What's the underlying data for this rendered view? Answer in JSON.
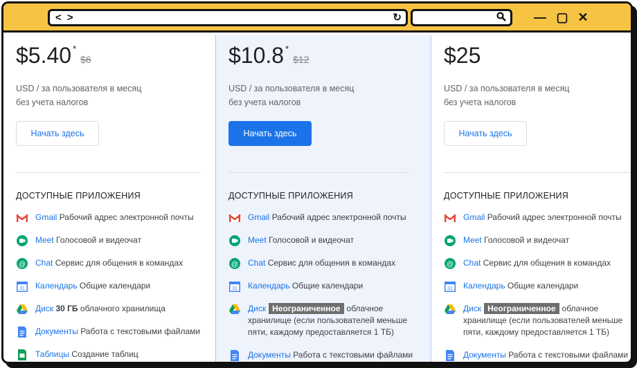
{
  "browser": {
    "nav_arrows": "< >"
  },
  "section_title": "ДОСТУПНЫЕ ПРИЛОЖЕНИЯ",
  "plans": [
    {
      "price": "$5.40",
      "star": "*",
      "old_price": "$6",
      "sub1": "USD / за пользователя в месяц",
      "sub2": "без учета налогов",
      "button": "Начать здесь",
      "apps": [
        {
          "name": "Gmail",
          "desc": "Рабочий адрес электронной почты"
        },
        {
          "name": "Meet",
          "desc": "Голосовой и видеочат"
        },
        {
          "name": "Chat",
          "desc": "Сервис для общения в командах"
        },
        {
          "name": "Календарь",
          "desc": "Общие календари"
        },
        {
          "name": "Диск",
          "pre": "30 ГБ",
          "desc": "облачного хранилища"
        },
        {
          "name": "Документы",
          "desc": "Работа с текстовыми файлами"
        },
        {
          "name": "Таблицы",
          "desc": "Создание таблиц"
        }
      ]
    },
    {
      "price": "$10.8",
      "star": "*",
      "old_price": "$12",
      "sub1": "USD / за пользователя в месяц",
      "sub2": "без учета налогов",
      "button": "Начать здесь",
      "apps": [
        {
          "name": "Gmail",
          "desc": "Рабочий адрес электронной почты"
        },
        {
          "name": "Meet",
          "desc": "Голосовой и видеочат"
        },
        {
          "name": "Chat",
          "desc": "Сервис для общения в командах"
        },
        {
          "name": "Календарь",
          "desc": "Общие календари"
        },
        {
          "name": "Диск",
          "tag": "Неограниченное",
          "desc": "облачное хранилище (если пользователей меньше пяти, каждому предоставляется 1 ТБ)"
        },
        {
          "name": "Документы",
          "desc": "Работа с текстовыми файлами"
        }
      ]
    },
    {
      "price": "$25",
      "sub1": "USD / за пользователя в месяц",
      "sub2": "без учета налогов",
      "button": "Начать здесь",
      "apps": [
        {
          "name": "Gmail",
          "desc": "Рабочий адрес электронной почты"
        },
        {
          "name": "Meet",
          "desc": "Голосовой и видеочат"
        },
        {
          "name": "Chat",
          "desc": "Сервис для общения в командах"
        },
        {
          "name": "Календарь",
          "desc": "Общие календари"
        },
        {
          "name": "Диск",
          "tag": "Неограниченное",
          "desc": "облачное хранилище (если пользователей меньше пяти, каждому предоставляется 1 ТБ)"
        },
        {
          "name": "Документы",
          "desc": "Работа с текстовыми файлами"
        }
      ]
    }
  ],
  "colors": {
    "accent": "#1a73e8",
    "titlebar": "#f6c343",
    "highlight_column": "#eef3fc"
  }
}
